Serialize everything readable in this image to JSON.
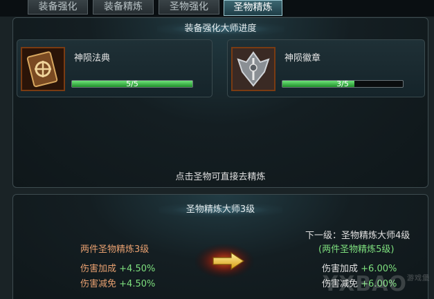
{
  "tabs": [
    {
      "label": "装备强化",
      "active": false
    },
    {
      "label": "装备精炼",
      "active": false
    },
    {
      "label": "圣物强化",
      "active": false
    },
    {
      "label": "圣物精炼",
      "active": true
    }
  ],
  "top_panel": {
    "title": "装备强化大师进度",
    "cards": [
      {
        "name": "神陨法典",
        "progress_text": "5/5",
        "progress": 1.0,
        "icon": "book-icon"
      },
      {
        "name": "神陨徽章",
        "progress_text": "3/5",
        "progress": 0.6,
        "icon": "badge-icon"
      }
    ],
    "hint": "点击圣物可直接去精炼"
  },
  "bottom_panel": {
    "title": "圣物精炼大师3级",
    "current": {
      "requirement": "两件圣物精炼3级",
      "stats": [
        {
          "label": "伤害加成",
          "value": "+4.50%"
        },
        {
          "label": "伤害减免",
          "value": "+4.50%"
        }
      ]
    },
    "next": {
      "title": "下一级：圣物精炼大师4级",
      "requirement": "(两件圣物精炼5级)",
      "stats": [
        {
          "label": "伤害加成",
          "value": "+6.00%"
        },
        {
          "label": "伤害减免",
          "value": "+6.00%"
        }
      ]
    }
  },
  "watermark": {
    "text": "YXBAO",
    "sub": "游戏堡"
  },
  "colors": {
    "requirement_current": "#e8a070",
    "stat_label_current": "#e8a070",
    "stat_value": "#7ee07e",
    "requirement_next": "#7ee07e",
    "bar_fill": "#3fc04c"
  }
}
